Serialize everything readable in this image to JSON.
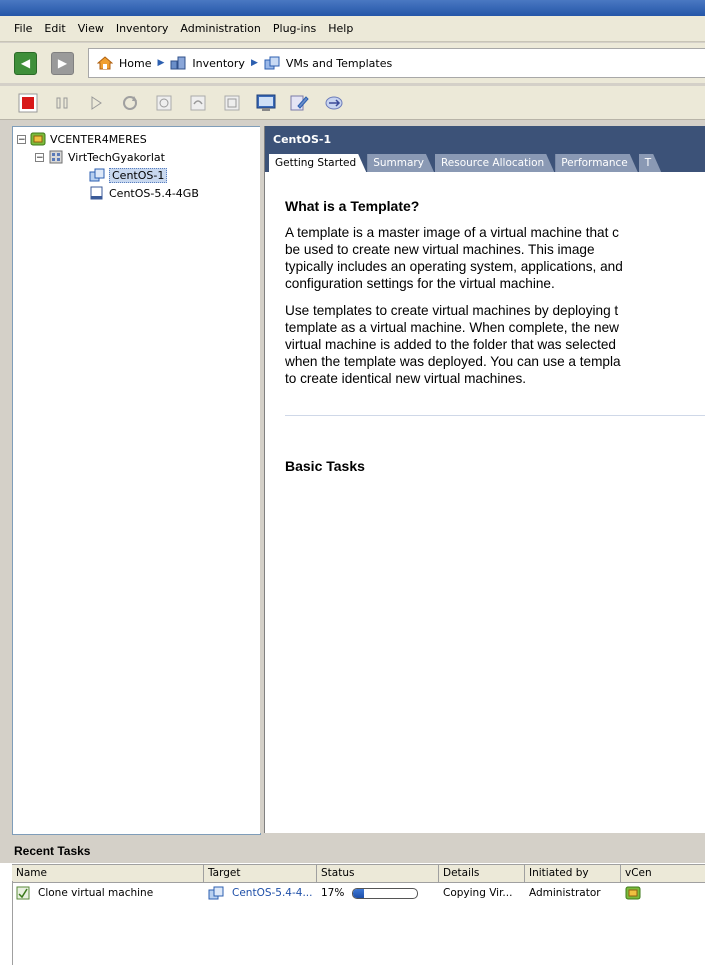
{
  "menu": [
    "File",
    "Edit",
    "View",
    "Inventory",
    "Administration",
    "Plug-ins",
    "Help"
  ],
  "breadcrumb": {
    "home": "Home",
    "inventory": "Inventory",
    "vms": "VMs and Templates"
  },
  "toolbar": {
    "icons": [
      "power-off-icon",
      "suspend-icon",
      "power-on-icon",
      "reset-icon",
      "snapshot-icon",
      "revert-snapshot-icon",
      "snapshot-manager-icon",
      "console-icon",
      "edit-settings-icon",
      "migrate-icon"
    ]
  },
  "tree": {
    "root": "VCENTER4MERES",
    "datacenter": "VirtTechGyakorlat",
    "items": [
      "CentOS-1",
      "CentOS-5.4-4GB"
    ]
  },
  "object": {
    "title": "CentOS-1",
    "tabs": [
      "Getting Started",
      "Summary",
      "Resource Allocation",
      "Performance",
      "T"
    ]
  },
  "content": {
    "heading": "What is a Template?",
    "para1": [
      "A template is a master image of a virtual machine that c",
      "be used to create new virtual machines. This image",
      "typically includes an operating system, applications, and",
      "configuration settings for the virtual machine."
    ],
    "para2": [
      "Use templates to create virtual machines by deploying t",
      "template as a virtual machine. When complete, the new",
      "virtual machine is added to the folder that was selected",
      "when the template was deployed. You can use a templa",
      "to create identical new virtual machines."
    ],
    "basic_tasks": "Basic Tasks"
  },
  "recent_tasks": {
    "title": "Recent Tasks",
    "columns": [
      "Name",
      "Target",
      "Status",
      "Details",
      "Initiated by",
      "vCen"
    ],
    "rows": [
      {
        "name": "Clone virtual machine",
        "target": "CentOS-5.4-4...",
        "status": "17%",
        "progress": 0.17,
        "details": "Copying Vir...",
        "initiated_by": "Administrator"
      }
    ]
  }
}
